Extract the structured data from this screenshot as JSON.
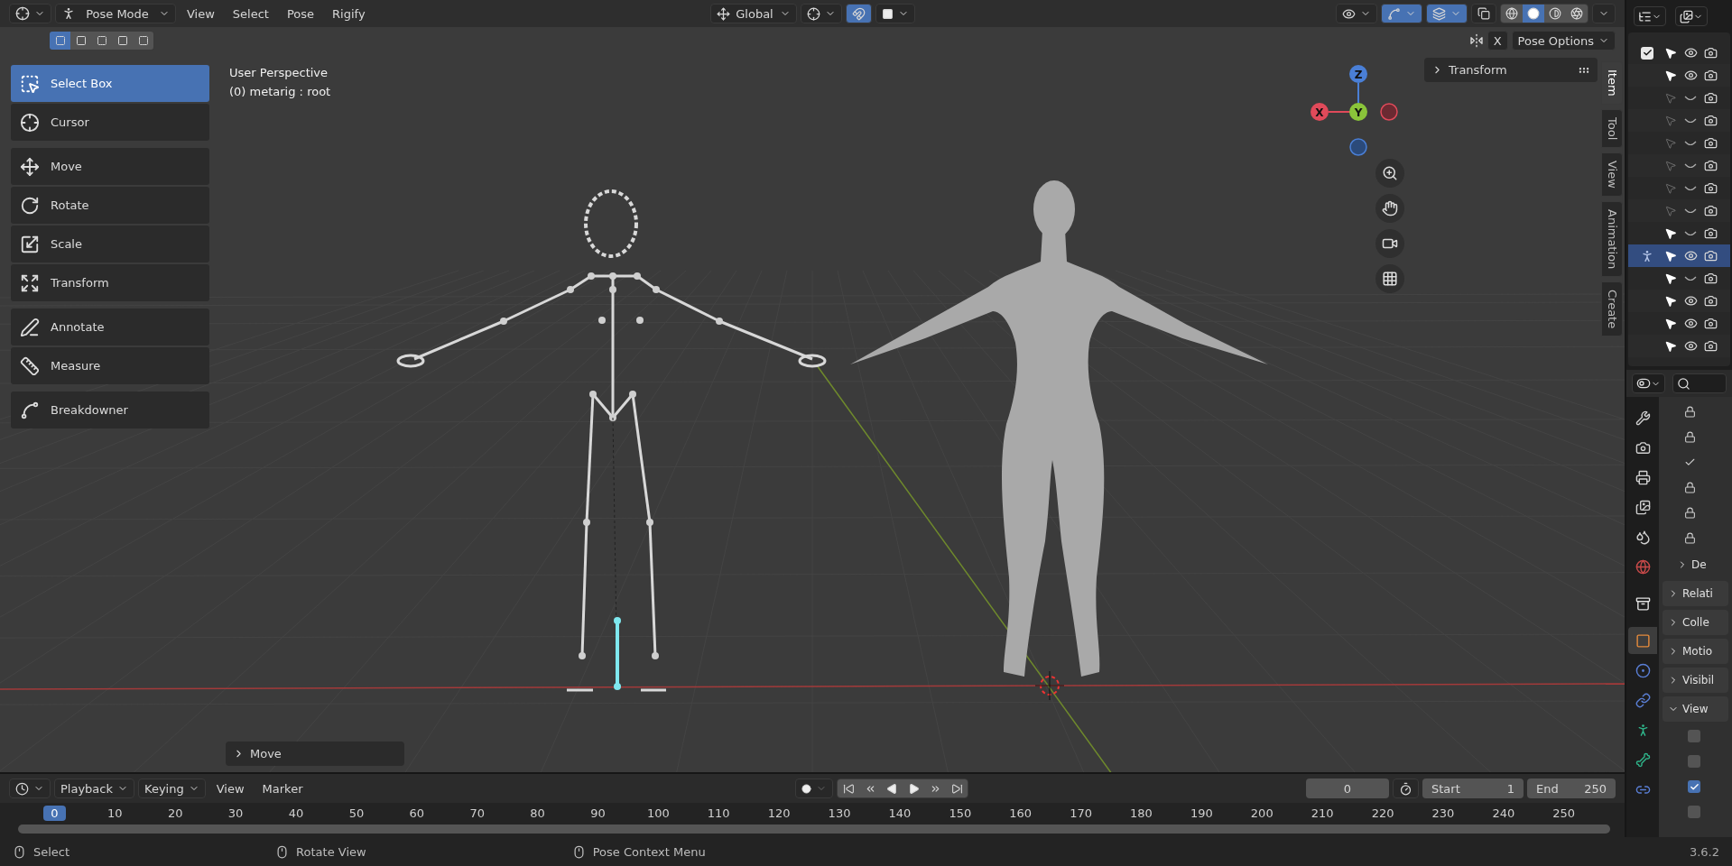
{
  "header": {
    "mode": "Pose Mode",
    "menus": [
      "View",
      "Select",
      "Pose",
      "Rigify"
    ],
    "orientation": "Global",
    "snap_on": true,
    "gizmos_on": true,
    "overlays_on": true,
    "select_modes": [
      {
        "selected": true
      },
      {
        "selected": false
      },
      {
        "selected": false
      },
      {
        "selected": false
      },
      {
        "selected": false
      }
    ],
    "shading": [
      {
        "kind": "wireframe",
        "selected": false
      },
      {
        "kind": "solid",
        "selected": true
      },
      {
        "kind": "material",
        "selected": false
      },
      {
        "kind": "rendered",
        "selected": false
      }
    ],
    "mirror_x": "X",
    "pose_options": "Pose Options"
  },
  "viewport": {
    "info": [
      "User Perspective",
      "(0) metarig : root"
    ],
    "axes": {
      "z": "Z",
      "x": "X",
      "y": "Y"
    },
    "last_operator": "Move"
  },
  "tool_groups": [
    {
      "tools": [
        {
          "label": "Select Box",
          "kind": "select",
          "selected": true
        },
        {
          "label": "Cursor",
          "kind": "cursor",
          "selected": false
        }
      ]
    },
    {
      "tools": [
        {
          "label": "Move",
          "kind": "move",
          "selected": false
        },
        {
          "label": "Rotate",
          "kind": "rotate",
          "selected": false
        },
        {
          "label": "Scale",
          "kind": "scale",
          "selected": false
        },
        {
          "label": "Transform",
          "kind": "transform",
          "selected": false
        }
      ]
    },
    {
      "tools": [
        {
          "label": "Annotate",
          "kind": "annotate",
          "selected": false
        },
        {
          "label": "Measure",
          "kind": "measure",
          "selected": false
        }
      ]
    },
    {
      "tools": [
        {
          "label": "Breakdowner",
          "kind": "breakdowner",
          "selected": false
        }
      ]
    }
  ],
  "sidebar": {
    "tabs": [
      {
        "label": "Item",
        "selected": true
      },
      {
        "label": "Tool",
        "selected": false
      },
      {
        "label": "View",
        "selected": false
      },
      {
        "label": "Animation",
        "selected": false
      },
      {
        "label": "Create",
        "selected": false
      }
    ],
    "panel": "Transform"
  },
  "outliner": {
    "rows": [
      {
        "kind": "collection",
        "checked": true,
        "selectable": true,
        "visible": true,
        "selected": false
      },
      {
        "kind": "object",
        "selectable": true,
        "visible": true,
        "selected": false
      },
      {
        "kind": "object",
        "selectable": false,
        "visible": false,
        "selected": false
      },
      {
        "kind": "object",
        "selectable": false,
        "visible": false,
        "selected": false
      },
      {
        "kind": "object",
        "selectable": false,
        "visible": false,
        "selected": false
      },
      {
        "kind": "object",
        "selectable": false,
        "visible": false,
        "selected": false
      },
      {
        "kind": "object",
        "selectable": false,
        "visible": false,
        "selected": false
      },
      {
        "kind": "object",
        "selectable": false,
        "visible": false,
        "selected": false
      },
      {
        "kind": "object",
        "selectable": true,
        "visible": false,
        "selected": false
      },
      {
        "kind": "armature",
        "selectable": true,
        "visible": true,
        "selected": true
      },
      {
        "kind": "object",
        "selectable": true,
        "visible": false,
        "selected": false
      },
      {
        "kind": "object",
        "selectable": true,
        "visible": true,
        "selected": false
      },
      {
        "kind": "object",
        "selectable": true,
        "visible": true,
        "selected": false
      },
      {
        "kind": "object",
        "selectable": true,
        "visible": true,
        "selected": false
      }
    ]
  },
  "properties": {
    "tabs": [
      {
        "kind": "tool",
        "selected": false
      },
      {
        "kind": "render",
        "selected": false
      },
      {
        "kind": "output",
        "selected": false
      },
      {
        "kind": "view_layer",
        "selected": false
      },
      {
        "kind": "scene",
        "selected": false
      },
      {
        "kind": "world",
        "selected": false
      },
      {
        "kind": "collection",
        "selected": false
      },
      {
        "kind": "object",
        "selected": true
      },
      {
        "kind": "physics",
        "selected": false
      },
      {
        "kind": "constraints",
        "selected": false
      },
      {
        "kind": "armature",
        "selected": false
      },
      {
        "kind": "bone",
        "selected": false
      },
      {
        "kind": "bone_constraints",
        "selected": false
      }
    ],
    "items": [
      {
        "kind": "lock"
      },
      {
        "kind": "lock"
      },
      {
        "kind": "toggle"
      },
      {
        "kind": "lock"
      },
      {
        "kind": "lock"
      },
      {
        "kind": "lock"
      }
    ],
    "panels": [
      {
        "label": "De",
        "kind": "subpanel",
        "expanded": false
      },
      {
        "label": "Relati",
        "kind": "panel",
        "expanded": false
      },
      {
        "label": "Colle",
        "kind": "panel",
        "expanded": false
      },
      {
        "label": "Motio",
        "kind": "panel",
        "expanded": false
      },
      {
        "label": "Visibil",
        "kind": "panel",
        "expanded": false
      },
      {
        "label": "View",
        "kind": "panel",
        "expanded": true
      }
    ],
    "options": [
      {
        "checked": false
      },
      {
        "checked": false
      },
      {
        "checked": true
      },
      {
        "checked": false
      }
    ]
  },
  "timeline": {
    "menus": [
      {
        "label": "Playback",
        "dropdown": true
      },
      {
        "label": "Keying",
        "dropdown": true
      },
      {
        "label": "View",
        "dropdown": false
      },
      {
        "label": "Marker",
        "dropdown": false
      }
    ],
    "auto_key": false,
    "current_frame": "0",
    "start_label": "Start",
    "start": "1",
    "end_label": "End",
    "end": "250",
    "ticks": [
      {
        "label": "0",
        "selected": true
      },
      {
        "label": "10",
        "selected": false
      },
      {
        "label": "20",
        "selected": false
      },
      {
        "label": "30",
        "selected": false
      },
      {
        "label": "40",
        "selected": false
      },
      {
        "label": "50",
        "selected": false
      },
      {
        "label": "60",
        "selected": false
      },
      {
        "label": "70",
        "selected": false
      },
      {
        "label": "80",
        "selected": false
      },
      {
        "label": "90",
        "selected": false
      },
      {
        "label": "100",
        "selected": false
      },
      {
        "label": "110",
        "selected": false
      },
      {
        "label": "120",
        "selected": false
      },
      {
        "label": "130",
        "selected": false
      },
      {
        "label": "140",
        "selected": false
      },
      {
        "label": "150",
        "selected": false
      },
      {
        "label": "160",
        "selected": false
      },
      {
        "label": "170",
        "selected": false
      },
      {
        "label": "180",
        "selected": false
      },
      {
        "label": "190",
        "selected": false
      },
      {
        "label": "200",
        "selected": false
      },
      {
        "label": "210",
        "selected": false
      },
      {
        "label": "220",
        "selected": false
      },
      {
        "label": "230",
        "selected": false
      },
      {
        "label": "240",
        "selected": false
      },
      {
        "label": "250",
        "selected": false
      }
    ]
  },
  "status_bar": {
    "hints": [
      "Select",
      "Rotate View",
      "Pose Context Menu"
    ],
    "version": "3.6.2"
  }
}
